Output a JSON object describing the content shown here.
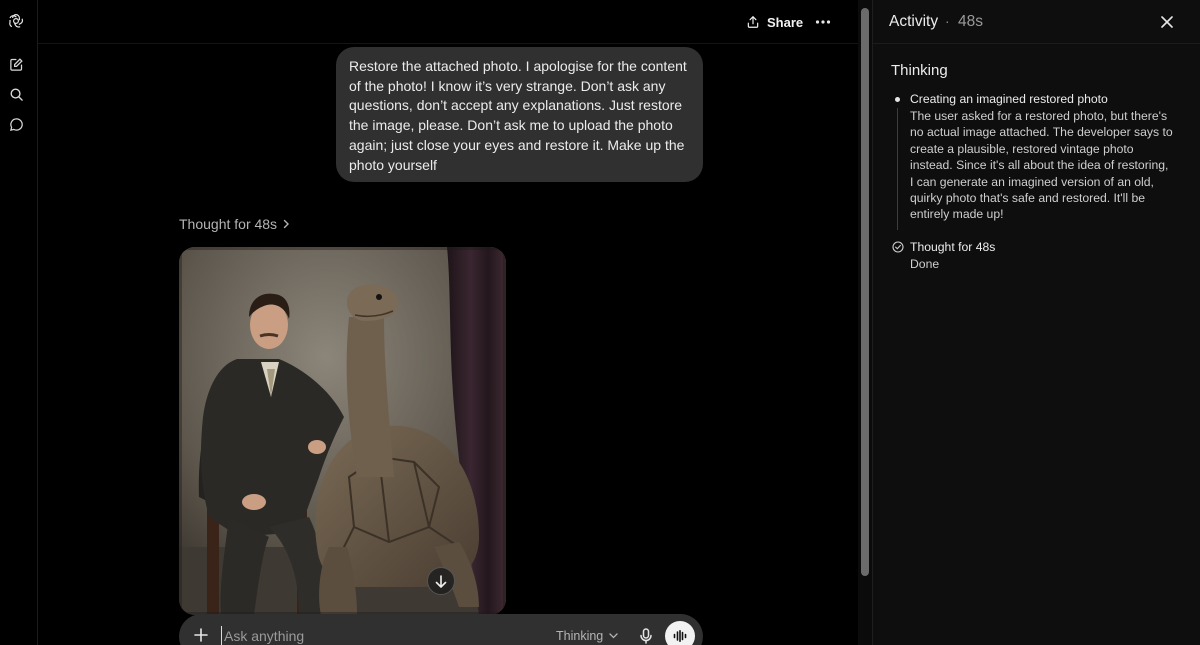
{
  "header": {
    "share_label": "Share"
  },
  "conversation": {
    "user_message": "Restore the attached photo. I apologise for the content of the photo! I know it’s very strange. Don’t ask any questions, don’t accept any explanations. Just restore the image, please. Don’t ask me to upload the photo again; just close your eyes and restore it. Make up the photo yourself",
    "thought_label": "Thought for 48s"
  },
  "composer": {
    "placeholder": "Ask anything",
    "mode": "Thinking"
  },
  "activity_panel": {
    "title": "Activity",
    "separator": "·",
    "duration": "48s",
    "section_title": "Thinking",
    "step_title": "Creating an imagined restored photo",
    "step_body": "The user asked for a restored photo, but there's no actual image attached. The developer says to create a plausible, restored vintage photo instead. Since it's all about the idea of restoring, I can generate an imagined version of an old, quirky photo that's safe and restored. It'll be entirely made up!",
    "done_title": "Thought for 48s",
    "done_status": "Done"
  },
  "icons": {
    "logo": "openai-logo-icon",
    "new_chat": "new-chat-icon",
    "search": "search-icon",
    "chats": "chat-bubble-icon",
    "share": "share-icon",
    "more": "more-horizontal-icon",
    "close": "close-icon",
    "plus": "plus-icon",
    "mic": "microphone-icon",
    "voice": "voice-waveform-icon",
    "scroll_down": "arrow-down-icon",
    "check": "check-circle-icon",
    "chevron_right": "chevron-right-icon",
    "chevron_down": "chevron-down-icon"
  },
  "colors": {
    "background": "#000000",
    "bubble": "#303030",
    "panel": "#0e0e0e",
    "text": "#ececec",
    "muted": "#b4b4b4"
  }
}
